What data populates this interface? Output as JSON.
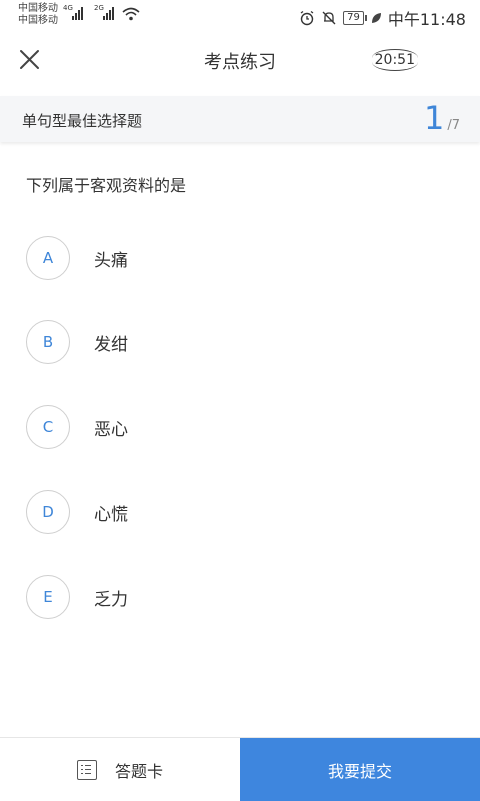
{
  "status_bar": {
    "carrier_1": "中国移动",
    "carrier_2": "中国移动",
    "signal_1_tag": "4G",
    "signal_2_tag": "2G",
    "battery": "79",
    "time": "中午11:48"
  },
  "header": {
    "title": "考点练习",
    "timer": "20:51"
  },
  "section": {
    "label": "单句型最佳选择题",
    "current": "1",
    "separator": "/",
    "total": "7"
  },
  "question": {
    "text": "下列属于客观资料的是",
    "options": [
      {
        "key": "A",
        "text": "头痛"
      },
      {
        "key": "B",
        "text": "发绀"
      },
      {
        "key": "C",
        "text": "恶心"
      },
      {
        "key": "D",
        "text": "心慌"
      },
      {
        "key": "E",
        "text": "乏力"
      }
    ]
  },
  "bottom_bar": {
    "answer_card_label": "答题卡",
    "submit_label": "我要提交"
  },
  "colors": {
    "accent": "#3e86de",
    "option_letter": "#3f86d8",
    "section_bg": "#f5f6f8"
  }
}
